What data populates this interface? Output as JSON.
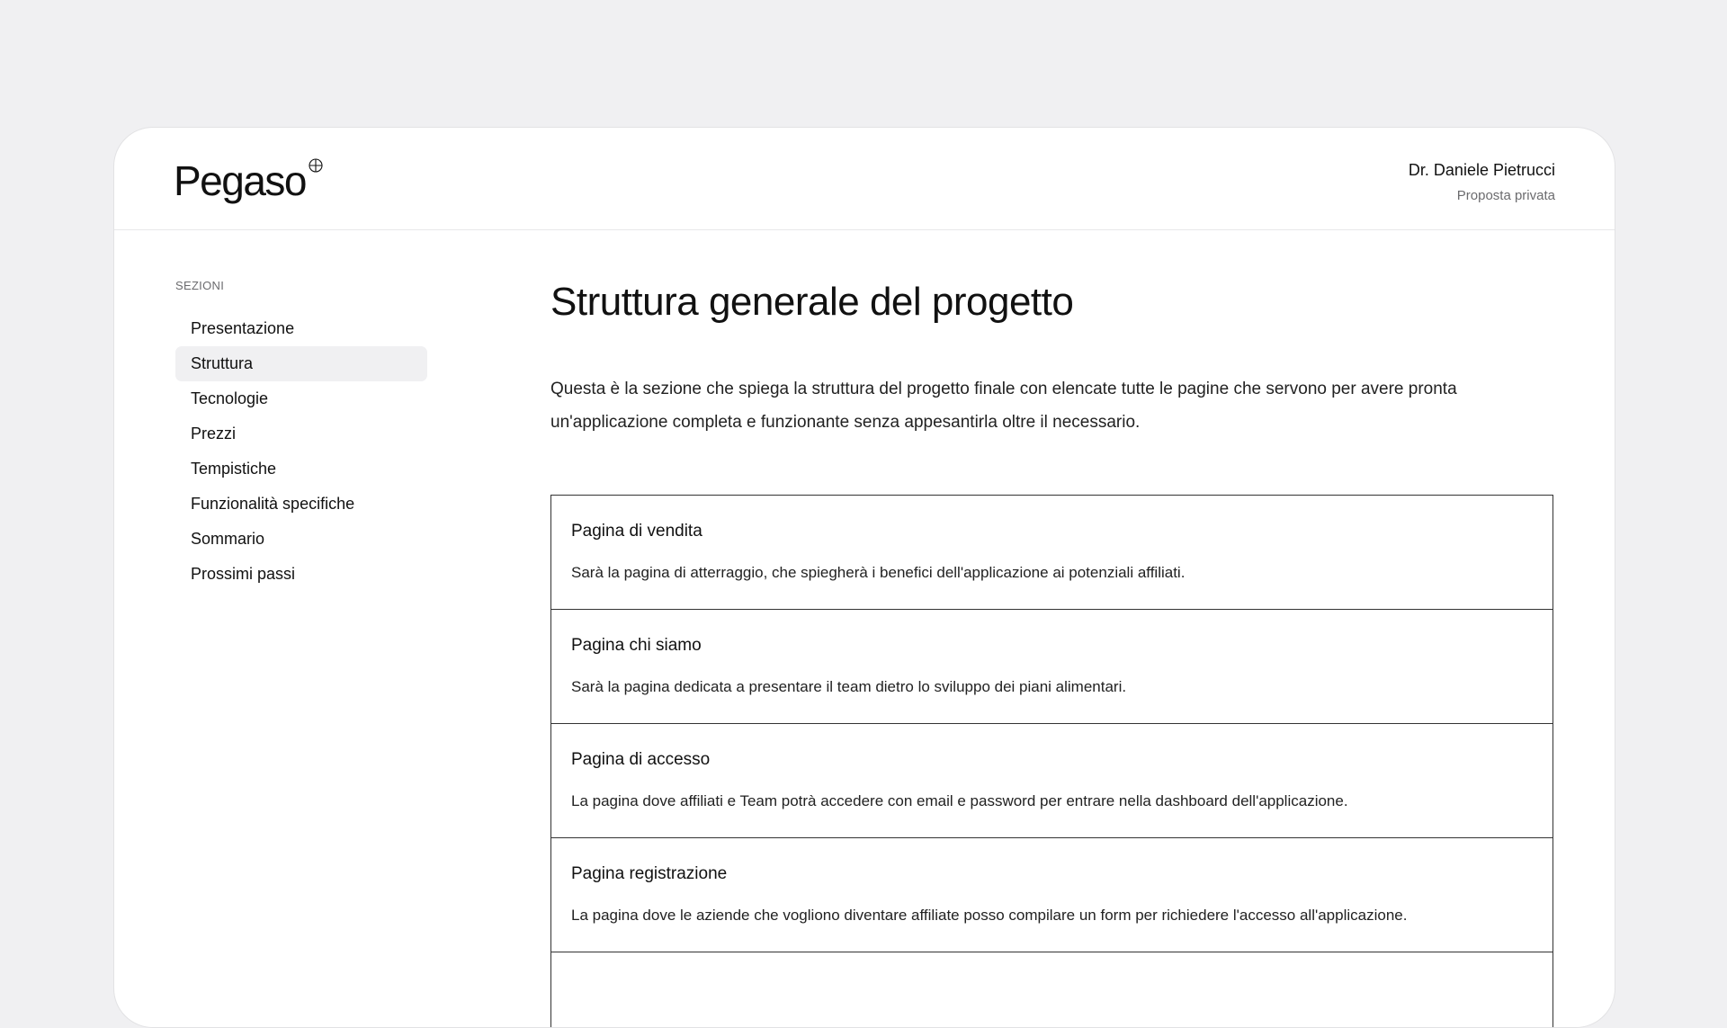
{
  "header": {
    "logo_text": "Pegaso",
    "logo_icon": "circle-plus-icon",
    "user_name": "Dr. Daniele Pietrucci",
    "user_subtitle": "Proposta privata"
  },
  "sidebar": {
    "heading": "SEZIONI",
    "active_index": 1,
    "items": [
      {
        "label": "Presentazione"
      },
      {
        "label": "Struttura"
      },
      {
        "label": "Tecnologie"
      },
      {
        "label": "Prezzi"
      },
      {
        "label": "Tempistiche"
      },
      {
        "label": "Funzionalità specifiche"
      },
      {
        "label": "Sommario"
      },
      {
        "label": "Prossimi passi"
      }
    ]
  },
  "main": {
    "title": "Struttura generale del progetto",
    "intro": "Questa è la sezione che spiega la struttura del progetto finale con elencate tutte le pagine che servono per avere pronta un'applicazione completa e funzionante senza appesantirla oltre il necessario.",
    "sections": [
      {
        "title": "Pagina di vendita",
        "description": "Sarà la pagina di atterraggio, che spiegherà i benefici dell'applicazione ai potenziali affiliati."
      },
      {
        "title": "Pagina chi siamo",
        "description": "Sarà la pagina dedicata a presentare il team dietro lo sviluppo dei piani alimentari."
      },
      {
        "title": "Pagina di accesso",
        "description": "La pagina dove affiliati e Team potrà accedere con email e password per entrare nella dashboard dell'applicazione."
      },
      {
        "title": "Pagina registrazione",
        "description": "La pagina dove le aziende che vogliono diventare affiliate posso compilare un form per richiedere l'accesso all'applicazione."
      }
    ]
  }
}
